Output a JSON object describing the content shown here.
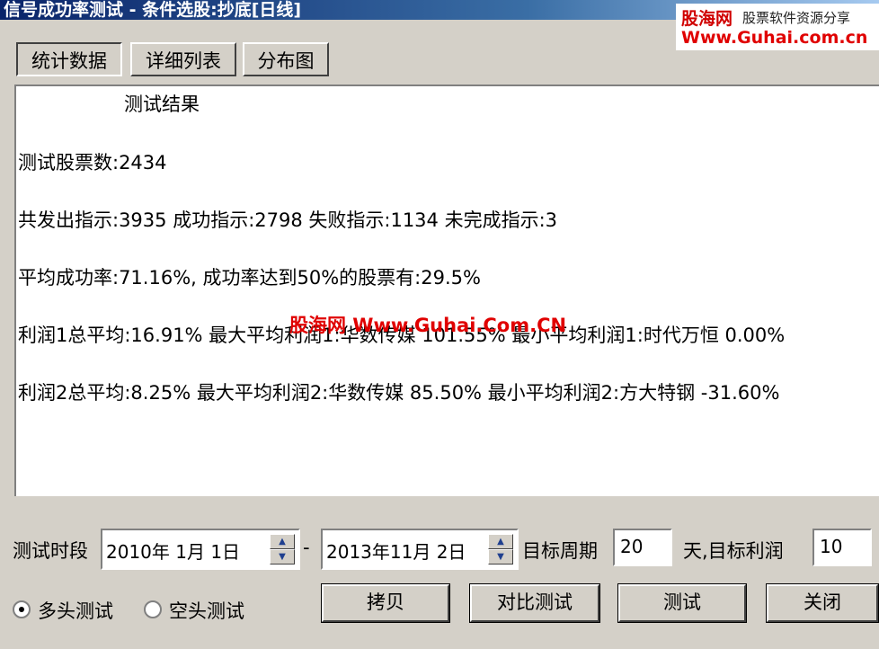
{
  "window": {
    "title": "信号成功率测试 - 条件选股:抄底[日线]"
  },
  "brand": {
    "name": "股海网",
    "tagline": "股票软件资源分享",
    "url": "Www.Guhai.com.cn"
  },
  "tabs": [
    {
      "label": "统计数据",
      "active": true
    },
    {
      "label": "详细列表",
      "active": false
    },
    {
      "label": "分布图",
      "active": false
    }
  ],
  "results": {
    "heading": "测试结果",
    "lines": [
      "测试股票数:2434",
      "共发出指示:3935 成功指示:2798 失败指示:1134 未完成指示:3",
      "平均成功率:71.16%, 成功率达到50%的股票有:29.5%",
      "利润1总平均:16.91% 最大平均利润1:华数传媒 101.55% 最小平均利润1:时代万恒 0.00%",
      "利润2总平均:8.25% 最大平均利润2:华数传媒 85.50% 最小平均利润2:方大特钢 -31.60%"
    ],
    "watermark": "股海网 Www.Guhai.Com.CN"
  },
  "controls": {
    "period_label": "测试时段",
    "start_date": "2010年  1月  1日",
    "separator": "-",
    "end_date": "2013年11月  2日",
    "target_period_label": "目标周期",
    "target_period_value": "20",
    "target_profit_label": "天,目标利润",
    "target_profit_value": "10"
  },
  "radios": [
    {
      "label": "多头测试",
      "checked": true
    },
    {
      "label": "空头测试",
      "checked": false
    }
  ],
  "buttons": {
    "copy": "拷贝",
    "compare": "对比测试",
    "test": "测试",
    "close": "关闭"
  },
  "icons": {
    "spin_up": "spin-up-icon",
    "spin_down": "spin-down-icon",
    "radio": "radio-icon"
  }
}
